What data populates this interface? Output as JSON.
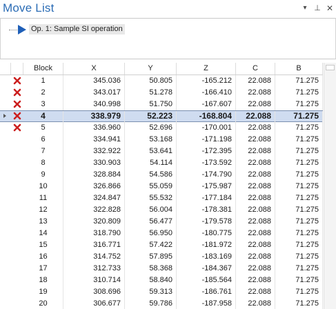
{
  "window": {
    "title": "Move List",
    "menu_glyph": "▾",
    "pin_glyph": "⊥",
    "close_glyph": "✕"
  },
  "tree": {
    "operation_label": "Op. 1: Sample SI operation"
  },
  "grid": {
    "columns": [
      "Block",
      "X",
      "Y",
      "Z",
      "C",
      "B"
    ],
    "selected_block": "4",
    "rows": [
      {
        "block": "1",
        "x": "345.036",
        "y": "50.805",
        "z": "-165.212",
        "c": "22.088",
        "b": "71.275",
        "error": true
      },
      {
        "block": "2",
        "x": "343.017",
        "y": "51.278",
        "z": "-166.410",
        "c": "22.088",
        "b": "71.275",
        "error": true
      },
      {
        "block": "3",
        "x": "340.998",
        "y": "51.750",
        "z": "-167.607",
        "c": "22.088",
        "b": "71.275",
        "error": true
      },
      {
        "block": "4",
        "x": "338.979",
        "y": "52.223",
        "z": "-168.804",
        "c": "22.088",
        "b": "71.275",
        "error": true
      },
      {
        "block": "5",
        "x": "336.960",
        "y": "52.696",
        "z": "-170.001",
        "c": "22.088",
        "b": "71.275",
        "error": true
      },
      {
        "block": "6",
        "x": "334.941",
        "y": "53.168",
        "z": "-171.198",
        "c": "22.088",
        "b": "71.275",
        "error": false
      },
      {
        "block": "7",
        "x": "332.922",
        "y": "53.641",
        "z": "-172.395",
        "c": "22.088",
        "b": "71.275",
        "error": false
      },
      {
        "block": "8",
        "x": "330.903",
        "y": "54.114",
        "z": "-173.592",
        "c": "22.088",
        "b": "71.275",
        "error": false
      },
      {
        "block": "9",
        "x": "328.884",
        "y": "54.586",
        "z": "-174.790",
        "c": "22.088",
        "b": "71.275",
        "error": false
      },
      {
        "block": "10",
        "x": "326.866",
        "y": "55.059",
        "z": "-175.987",
        "c": "22.088",
        "b": "71.275",
        "error": false
      },
      {
        "block": "11",
        "x": "324.847",
        "y": "55.532",
        "z": "-177.184",
        "c": "22.088",
        "b": "71.275",
        "error": false
      },
      {
        "block": "12",
        "x": "322.828",
        "y": "56.004",
        "z": "-178.381",
        "c": "22.088",
        "b": "71.275",
        "error": false
      },
      {
        "block": "13",
        "x": "320.809",
        "y": "56.477",
        "z": "-179.578",
        "c": "22.088",
        "b": "71.275",
        "error": false
      },
      {
        "block": "14",
        "x": "318.790",
        "y": "56.950",
        "z": "-180.775",
        "c": "22.088",
        "b": "71.275",
        "error": false
      },
      {
        "block": "15",
        "x": "316.771",
        "y": "57.422",
        "z": "-181.972",
        "c": "22.088",
        "b": "71.275",
        "error": false
      },
      {
        "block": "16",
        "x": "314.752",
        "y": "57.895",
        "z": "-183.169",
        "c": "22.088",
        "b": "71.275",
        "error": false
      },
      {
        "block": "17",
        "x": "312.733",
        "y": "58.368",
        "z": "-184.367",
        "c": "22.088",
        "b": "71.275",
        "error": false
      },
      {
        "block": "18",
        "x": "310.714",
        "y": "58.840",
        "z": "-185.564",
        "c": "22.088",
        "b": "71.275",
        "error": false
      },
      {
        "block": "19",
        "x": "308.696",
        "y": "59.313",
        "z": "-186.761",
        "c": "22.088",
        "b": "71.275",
        "error": false
      },
      {
        "block": "20",
        "x": "306.677",
        "y": "59.786",
        "z": "-187.958",
        "c": "22.088",
        "b": "71.275",
        "error": false
      }
    ]
  },
  "colors": {
    "title": "#2b6cb5",
    "selection": "#cfdcf0",
    "error_icon": "#cc1f1f"
  },
  "icons": {
    "row_error": "red-x-icon",
    "tree_node": "play-arrow-icon"
  }
}
